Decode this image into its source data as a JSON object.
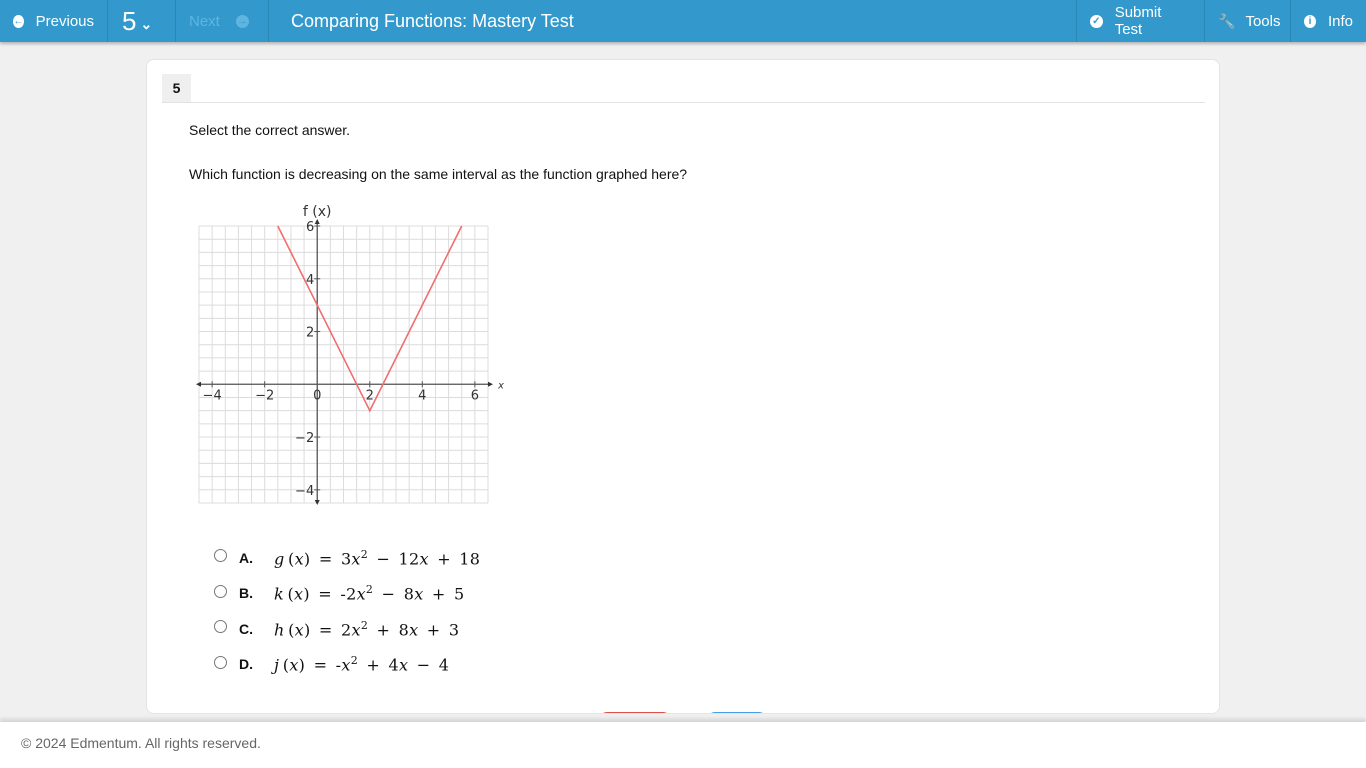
{
  "topbar": {
    "previous_label": "Previous",
    "previous_icon": "arrow-left-circle-icon",
    "question_number": "5",
    "question_dropdown_icon": "chevron-down-icon",
    "next_label": "Next",
    "next_icon": "arrow-right-circle-icon",
    "title": "Comparing Functions: Mastery Test",
    "submit_label": "Submit Test",
    "submit_icon": "check-circle-icon",
    "tools_label": "Tools",
    "tools_icon": "wrench-icon",
    "info_label": "Info",
    "info_icon": "info-circle-icon",
    "color": "#3399cc"
  },
  "question": {
    "number": "5",
    "instruction": "Select the correct answer.",
    "prompt": "Which function is decreasing on the same interval as the function graphed here?"
  },
  "chart_data": {
    "type": "line",
    "title": "",
    "xlabel": "x",
    "ylabel": "f (x)",
    "x_ticks": [
      -4,
      -2,
      0,
      2,
      4,
      6
    ],
    "y_ticks": [
      -4,
      -2,
      2,
      4,
      6
    ],
    "xlim": [
      -4.5,
      6.5
    ],
    "ylim": [
      -4.5,
      6
    ],
    "grid": true,
    "grid_step": 0.5,
    "series": [
      {
        "name": "f(x)",
        "color": "#f26d6d",
        "points": [
          [
            -1.5,
            6
          ],
          [
            2,
            -1
          ],
          [
            5.5,
            6
          ]
        ]
      }
    ]
  },
  "choices": [
    {
      "letter": "A.",
      "name": "g",
      "rhs": [
        "3",
        "x",
        "2",
        " − 12",
        "x",
        " + 18"
      ],
      "text": "g(x) = 3x² − 12x + 18"
    },
    {
      "letter": "B.",
      "name": "k",
      "rhs": [
        "-2",
        "x",
        "2",
        " − 8",
        "x",
        " + 5"
      ],
      "text": "k(x) = -2x² − 8x + 5"
    },
    {
      "letter": "C.",
      "name": "h",
      "rhs": [
        "2",
        "x",
        "2",
        " + 8",
        "x",
        " + 3"
      ],
      "text": "h(x) = 2x² + 8x + 3"
    },
    {
      "letter": "D.",
      "name": "j",
      "rhs": [
        "-",
        "x",
        "2",
        " + 4",
        "x",
        " − 4"
      ],
      "text": "j(x) = -x² + 4x − 4"
    }
  ],
  "footer": {
    "copyright": "© 2024 Edmentum. All rights reserved."
  }
}
